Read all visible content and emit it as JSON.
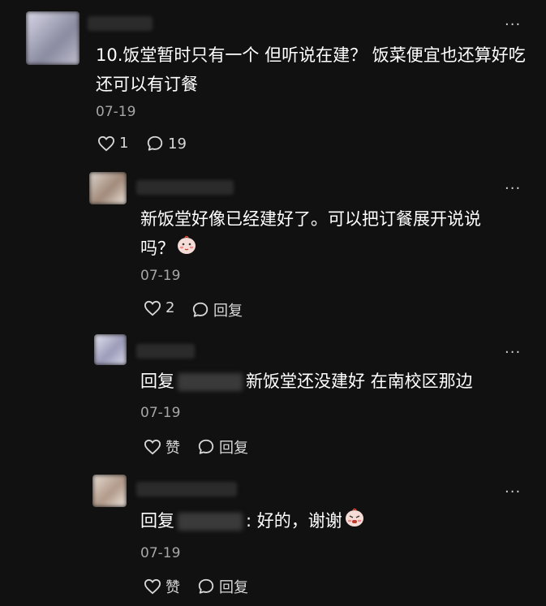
{
  "comments": [
    {
      "text": "10.饭堂暂时只有一个 但听说在建？ 饭菜便宜也还算好吃 还可以有订餐",
      "date": "07-19",
      "likes": "1",
      "replies": "19",
      "more": "···"
    },
    {
      "text": "新饭堂好像已经建好了。可以把订餐展开说说吗？",
      "date": "07-19",
      "likes": "2",
      "reply_label": "回复",
      "more": "···"
    },
    {
      "prefix": "回复",
      "text": "新饭堂还没建好 在南校区那边",
      "date": "07-19",
      "like_label": "赞",
      "reply_label": "回复",
      "more": "···"
    },
    {
      "prefix": "回复",
      "text": ": 好的，谢谢",
      "date": "07-19",
      "like_label": "赞",
      "reply_label": "回复",
      "more": "···"
    }
  ]
}
